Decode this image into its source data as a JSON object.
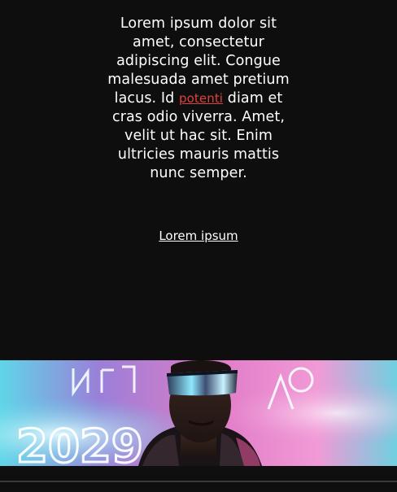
{
  "article": {
    "paragraph_before_link": "Lorem ipsum dolor sit amet, consectetur adipiscing elit. Congue malesuada amet pretium lacus. Id ",
    "inline_link_label": "potenti",
    "paragraph_after_link": " diam et cras odio viverra. Amet, velit ut hac sit. Enim ultricies mauris mattis nunc semper.",
    "cta_label": "Lorem ipsum"
  },
  "colors": {
    "background": "#0e0e0e",
    "text": "#ffffff",
    "link_accent": "#e0413f",
    "divider": "#3a3a3a"
  },
  "hero_image": {
    "subject": "person-with-cyber-visor",
    "neon_text": "2029"
  }
}
